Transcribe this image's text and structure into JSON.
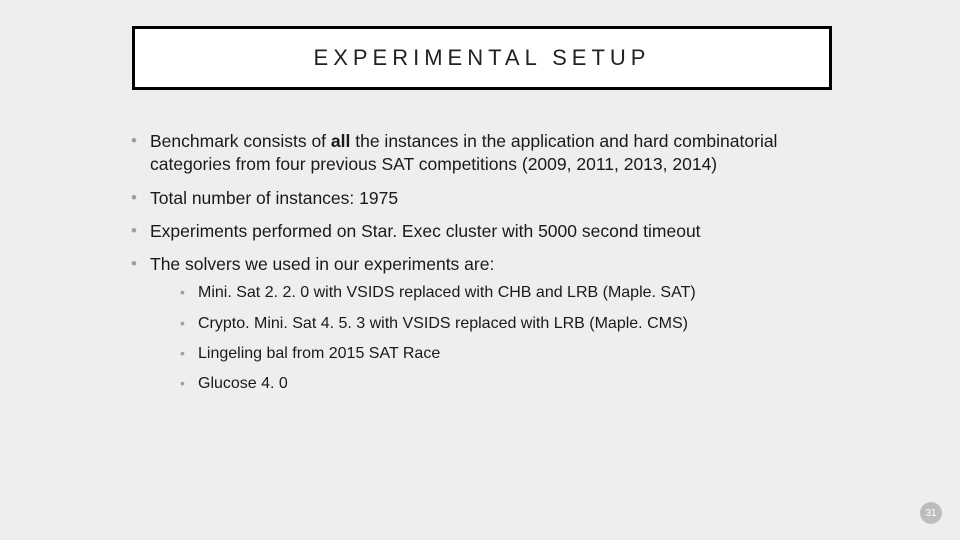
{
  "title": "EXPERIMENTAL SETUP",
  "bullets": {
    "b0_pre": "Benchmark consists of ",
    "b0_bold": "all",
    "b0_post": " the instances in the application and hard combinatorial categories from four previous SAT competitions (2009, 2011, 2013, 2014)",
    "b1": "Total number of instances: 1975",
    "b2": "Experiments performed on Star. Exec cluster with 5000 second timeout",
    "b3": "The solvers we used in our experiments are:"
  },
  "sub": {
    "s0": "Mini. Sat 2. 2. 0 with VSIDS replaced with CHB and LRB (Maple. SAT)",
    "s1": "Crypto. Mini. Sat 4. 5. 3 with VSIDS replaced with LRB (Maple. CMS)",
    "s2": "Lingeling bal from 2015 SAT Race",
    "s3": "Glucose 4. 0"
  },
  "page_number": "31"
}
